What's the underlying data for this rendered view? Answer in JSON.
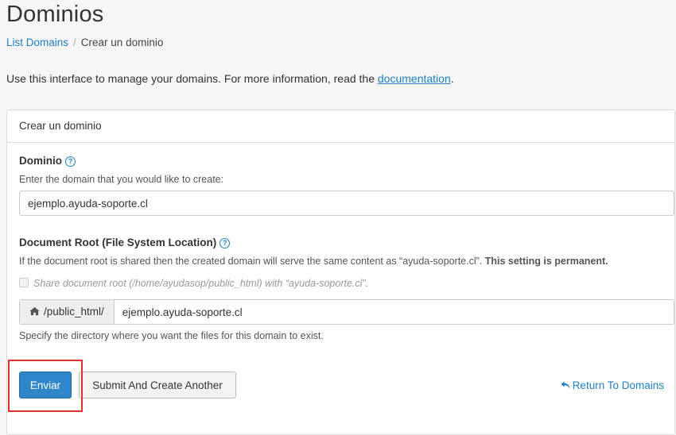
{
  "page": {
    "title": "Dominios",
    "breadcrumb": {
      "link": "List Domains",
      "separator": "/",
      "current": "Crear un dominio"
    },
    "intro_text": "Use this interface to manage your domains. For more information, read the ",
    "intro_link": "documentation",
    "intro_end": "."
  },
  "panel": {
    "heading": "Crear un dominio",
    "domain": {
      "label": "Dominio",
      "help_icon": "question-circle-icon",
      "hint": "Enter the domain that you would like to create:",
      "value": "ejemplo.ayuda-soporte.cl"
    },
    "docroot": {
      "label": "Document Root (File System Location)",
      "help_icon": "question-circle-icon",
      "hint_prefix": "If the document root is shared then the created domain will serve the same content as “ayuda-soporte.cl”. ",
      "hint_bold": "This setting is permanent.",
      "share_checkbox_label": "Share document root (/home/ayudasop/public_html) with “ayuda-soporte.cl”.",
      "share_checked": false,
      "prefix": "/public_html/",
      "prefix_icon": "home-icon",
      "value": "ejemplo.ayuda-soporte.cl",
      "specify_hint": "Specify the directory where you want the files for this domain to exist."
    },
    "actions": {
      "submit": "Enviar",
      "submit_another": "Submit And Create Another",
      "return_link": "Return To Domains",
      "return_icon": "reply-arrow-icon"
    }
  },
  "colors": {
    "link": "#1f7fc3",
    "primary_button": "#2f86c9",
    "highlight": "#e0302d"
  }
}
